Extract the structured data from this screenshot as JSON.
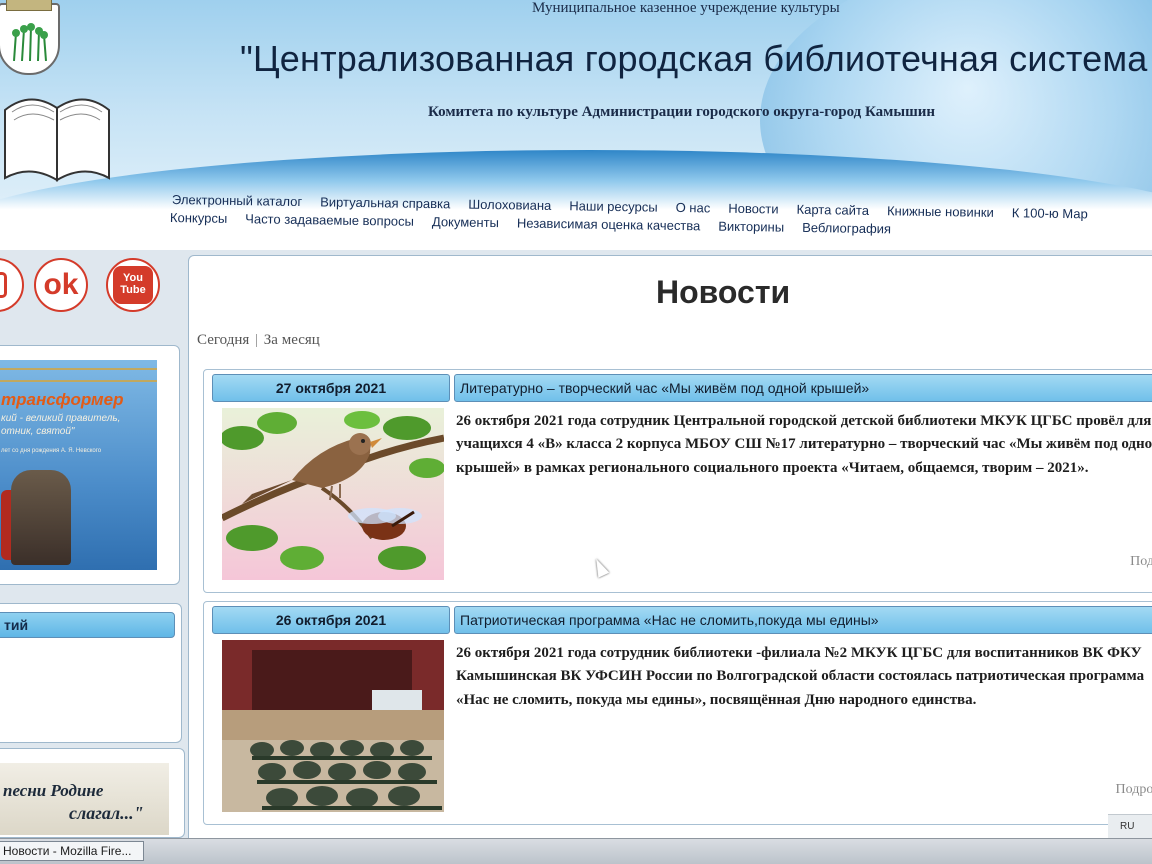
{
  "header": {
    "org_type": "Муниципальное казенное учреждение культуры",
    "title": "\"Централизованная городская библиотечная система",
    "subtitle": "Комитета по культуре Администрации городского округа-город Камышин"
  },
  "nav": {
    "row1": [
      "Электронный каталог",
      "Виртуальная справка",
      "Шолоховиана",
      "Наши ресурсы",
      "О нас",
      "Новости",
      "Карта сайта",
      "Книжные новинки",
      "К 100-ю Мар"
    ],
    "row2": [
      "Конкурсы",
      "Часто задаваемые вопросы",
      "Документы",
      "Независимая оценка качества",
      "Викторины",
      "Веблиография"
    ]
  },
  "social": {
    "ok_label": "ok",
    "youtube_top": "You",
    "youtube_bottom": "Tube"
  },
  "sidebar": {
    "promo": {
      "title": "трансформер",
      "subtitle_line1": "кий - великий правитель,",
      "subtitle_line2": "отник, святой\"",
      "note": "лет со дня рождения А. Я. Невского"
    },
    "box2_title": "тий",
    "poem_line1": "песни Родине",
    "poem_line2": "слагал...\""
  },
  "main": {
    "heading": "Новости",
    "filter_today": "Сегодня",
    "filter_sep": "|",
    "filter_month": "За месяц",
    "news": [
      {
        "date": "27 октября 2021",
        "title": "Литературно – творческий  час «Мы живём под одной крышей»",
        "text": "26 октября  2021 года сотрудник Центральной городской детской библиотеки МКУК ЦГБС провёл для учащихся 4 «В» класса 2 корпуса МБОУ СШ №17 литературно – творческий  час «Мы живём под одной крышей» в рамках  регионального социального проекта «Читаем, общаемся, творим – 2021».",
        "more": "Подро"
      },
      {
        "date": "26 октября 2021",
        "title": "Патриотическая программа «Нас не сломить,покуда мы едины»",
        "text": "26 октября 2021 года  сотрудник  библиотеки -филиала №2   МКУК ЦГБС  для воспитанников ВК ФКУ Камышинская ВК УФСИН России по Волгоградской области состоялась патриотическая программа «Нас не сломить, покуда мы едины», посвящённая Дню народного единства.",
        "more": "Подробн"
      }
    ]
  },
  "taskbar": {
    "task_label": "Новости - Mozilla Fire...",
    "lang": "RU"
  },
  "colors": {
    "tab_blue": "#70c0ea",
    "nav_text": "#152d56",
    "social_red": "#d43b2a"
  }
}
